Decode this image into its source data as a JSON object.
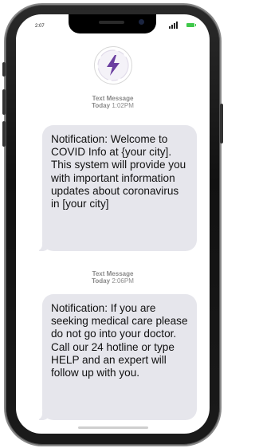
{
  "status_bar": {
    "time": "2:07",
    "battery_color": "#3fc84a"
  },
  "contact": {
    "avatar_icon": "lightning-bolt-icon",
    "accent_color": "#6b3fa0"
  },
  "messages": [
    {
      "sender": "Text Message",
      "day": "Today",
      "time": "1:02PM",
      "text": "Notification: Welcome to COVID Info at {your city]. This system will provide you with important information updates about coronavirus in [your city]"
    },
    {
      "sender": "Text Message",
      "day": "Today",
      "time": "2:06PM",
      "text": "Notification: If you are seeking medical care please do not go into your doctor.  Call our 24 hotline or type HELP and an expert will follow up with you."
    }
  ]
}
